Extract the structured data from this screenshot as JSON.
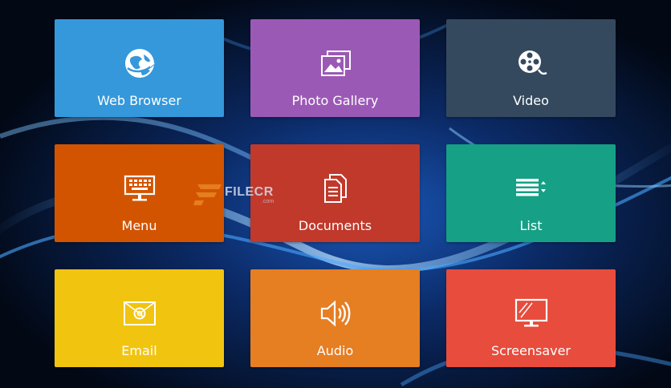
{
  "tiles": [
    {
      "label": "Web Browser",
      "icon": "globe-icon",
      "color": "#3498db"
    },
    {
      "label": "Photo Gallery",
      "icon": "photos-icon",
      "color": "#9b59b6"
    },
    {
      "label": "Video",
      "icon": "film-reel-icon",
      "color": "#34495e"
    },
    {
      "label": "Menu",
      "icon": "keyboard-icon",
      "color": "#d35400"
    },
    {
      "label": "Documents",
      "icon": "documents-icon",
      "color": "#c0392b"
    },
    {
      "label": "List",
      "icon": "list-sort-icon",
      "color": "#16a085"
    },
    {
      "label": "Email",
      "icon": "email-icon",
      "color": "#f1c40f"
    },
    {
      "label": "Audio",
      "icon": "speaker-icon",
      "color": "#e67e22"
    },
    {
      "label": "Screensaver",
      "icon": "monitor-icon",
      "color": "#e74c3c"
    }
  ],
  "watermark": {
    "text": "FILECR",
    "sub": ".com"
  }
}
